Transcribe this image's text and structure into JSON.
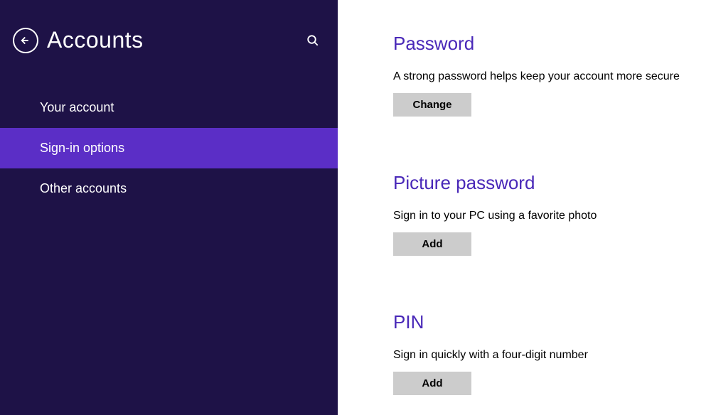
{
  "header": {
    "title": "Accounts"
  },
  "sidebar": {
    "items": [
      {
        "label": "Your account",
        "active": false
      },
      {
        "label": "Sign-in options",
        "active": true
      },
      {
        "label": "Other accounts",
        "active": false
      }
    ]
  },
  "sections": {
    "password": {
      "title": "Password",
      "desc": "A strong password helps keep your account more secure",
      "button": "Change"
    },
    "picture": {
      "title": "Picture password",
      "desc": "Sign in to your PC using a favorite photo",
      "button": "Add"
    },
    "pin": {
      "title": "PIN",
      "desc": "Sign in quickly with a four-digit number",
      "button": "Add"
    }
  }
}
